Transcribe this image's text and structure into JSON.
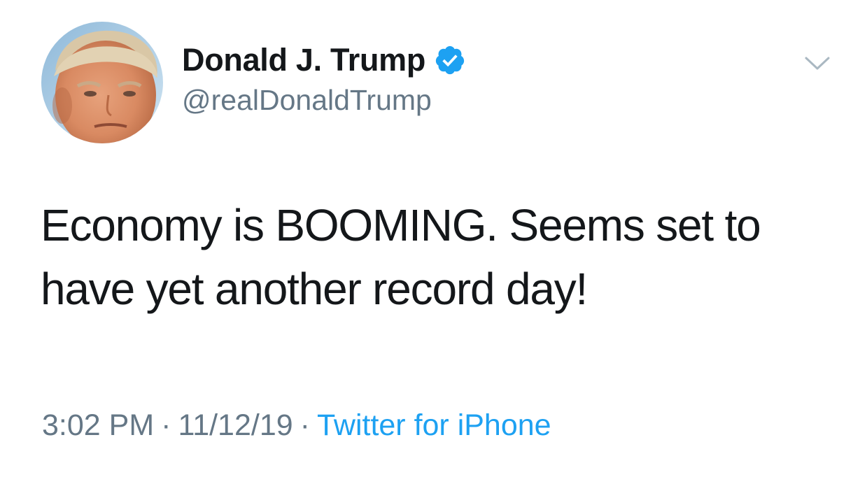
{
  "author": {
    "display_name": "Donald J. Trump",
    "handle": "@realDonaldTrump",
    "verified": true,
    "avatar_icon": "profile-photo"
  },
  "tweet": {
    "text_line_1": "Economy is BOOMING. Seems set to",
    "text_line_2": "have yet another record day!"
  },
  "meta": {
    "time": "3:02 PM",
    "separator": "·",
    "date": "11/12/19",
    "source": "Twitter for iPhone"
  },
  "icons": {
    "verified": "verified-badge-icon",
    "menu": "chevron-down-icon"
  },
  "colors": {
    "text": "#14171a",
    "secondary": "#657786",
    "accent": "#1da1f2",
    "background": "#ffffff"
  }
}
